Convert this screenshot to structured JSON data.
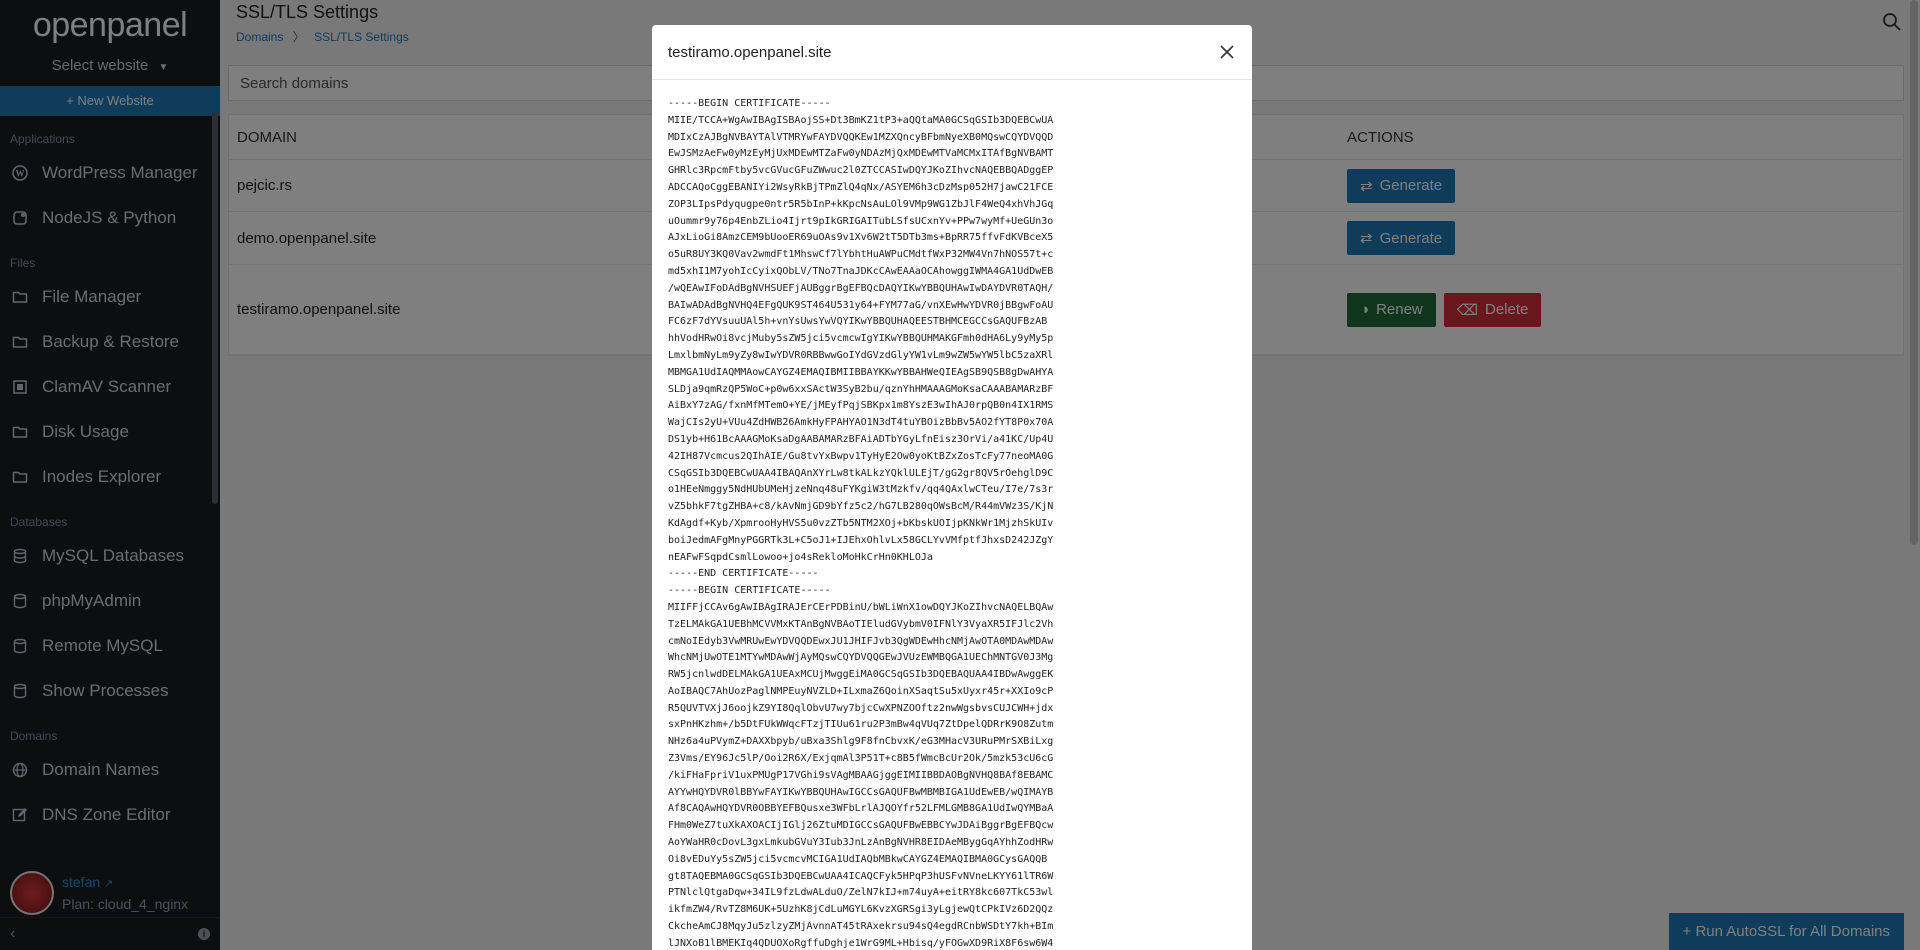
{
  "sidebar": {
    "logo": "openpanel",
    "select_website": "Select website",
    "new_website": "+ New Website",
    "sections": [
      {
        "label": "Applications",
        "items": [
          {
            "label": "WordPress Manager",
            "icon": "wordpress-icon"
          },
          {
            "label": "NodeJS & Python",
            "icon": "nodejs-icon"
          }
        ]
      },
      {
        "label": "Files",
        "items": [
          {
            "label": "File Manager",
            "icon": "folder-icon"
          },
          {
            "label": "Backup & Restore",
            "icon": "backup-icon"
          },
          {
            "label": "ClamAV Scanner",
            "icon": "scanner-icon"
          },
          {
            "label": "Disk Usage",
            "icon": "disk-icon"
          },
          {
            "label": "Inodes Explorer",
            "icon": "inodes-icon"
          }
        ]
      },
      {
        "label": "Databases",
        "items": [
          {
            "label": "MySQL Databases",
            "icon": "database-icon"
          },
          {
            "label": "phpMyAdmin",
            "icon": "phpmyadmin-icon"
          },
          {
            "label": "Remote MySQL",
            "icon": "remote-mysql-icon"
          },
          {
            "label": "Show Processes",
            "icon": "processes-icon"
          }
        ]
      },
      {
        "label": "Domains",
        "items": [
          {
            "label": "Domain Names",
            "icon": "globe-icon"
          },
          {
            "label": "DNS Zone Editor",
            "icon": "edit-icon"
          }
        ]
      }
    ],
    "user": {
      "name": "stefan",
      "plan": "Plan: cloud_4_nginx"
    }
  },
  "main": {
    "title": "SSL/TLS Settings",
    "breadcrumb": {
      "parent": "Domains",
      "current": "SSL/TLS Settings"
    },
    "search": {
      "placeholder": "Search domains"
    },
    "table": {
      "headers": {
        "domain": "DOMAIN",
        "actions": "ACTIONS"
      },
      "rows": [
        {
          "domain": "pejcic.rs",
          "actions": [
            "Generate"
          ]
        },
        {
          "domain": "demo.openpanel.site",
          "actions": [
            "Generate"
          ]
        },
        {
          "domain": "testiramo.openpanel.site",
          "actions": [
            "Renew",
            "Delete"
          ]
        }
      ]
    },
    "autossl_button": "+ Run AutoSSL for All Domains"
  },
  "modal": {
    "title": "testiramo.openpanel.site",
    "certificate": "-----BEGIN CERTIFICATE-----\nMIIE/TCCA+WgAwIBAgISBAojSS+Dt3BmKZ1tP3+aQQtaMA0GCSqGSIb3DQEBCwUA\nMDIxCzAJBgNVBAYTAlVTMRYwFAYDVQQKEw1MZXQncyBFbmNyeXB0MQswCQYDVQQD\nEwJSMzAeFw0yMzEyMjUxMDEwMTZaFw0yNDAzMjQxMDEwMTVaMCMxITAfBgNVBAMT\nGHRlc3RpcmFtby5vcGVucGFuZWwuc2l0ZTCCASIwDQYJKoZIhvcNAQEBBQADggEP\nADCCAQoCggEBANIYi2WsyRkBjTPmZlQ4qNx/ASYEM6h3cDzMsp052H7jawC21FCE\nZOP3LIpsPdyqugpe0ntr5R5bInP+kKpcNsAuLOl9VMp9WG1ZbJlF4WeQ4xhVhJGq\nuOummr9y76p4EnbZLio4Ijrt9pIkGRIGAITubLSfsUCxnYv+PPw7wyMf+UeGUn3o\nAJxLioGi8AmzCEM9bUooER69uOAs9v1Xv6W2tT5DTb3ms+BpRR75ffvFdKVBceX5\no5uR8UY3KQ0Vav2wmdFt1MhswCf7lYbhtHuAWPuCMdtfWxP32MW4Vn7hNOS57t+c\nmd5xhI1M7yohIcCyixQObLV/TNo7TnaJDKcCAwEAAaOCAhowggIWMA4GA1UdDwEB\n/wQEAwIFoDAdBgNVHSUEFjAUBggrBgEFBQcDAQYIKwYBBQUHAwIwDAYDVR0TAQH/\nBAIwADAdBgNVHQ4EFgQUK9ST464U531y64+FYM77aG/vnXEwHwYDVR0jBBgwFoAU\nFC6zF7dYVsuuUAl5h+vnYsUwsYwVQYIKwYBBQUHAQEESTBHMCEGCCsGAQUFBzAB\nhhVodHRwOi8vcjMuby5sZW5jci5vcmcwIgYIKwYBBQUHMAKGFmh0dHA6Ly9yMy5p\nLmxlbmNyLm9yZy8wIwYDVR0RBBwwGoIYdGVzdGlyYW1vLm9wZW5wYW5lbC5zaXRl\nMBMGA1UdIAQMMAowCAYGZ4EMAQIBMIIBBAYKKwYBBAHWeQIEAgSB9QSB8gDwAHYA\nSLDja9qmRzQP5WoC+p0w6xxSActW3SyB2bu/qznYhHMAAAGMoKsaCAAABAMARzBF\nAiBxY7zAG/fxnMfMTemO+YE/jMEyfPqjSBKpx1m8YszE3wIhAJ0rpQB0n4IX1RMS\nWajCIs2yU+VUu4ZdHWB26AmkHyFPAHYAO1N3dT4tuYBOizBbBv5AO2fYT8P0x70A\nDS1yb+H61BcAAAGMoKsaDgAABAMARzBFAiADTbYGyLfnEisz3OrVi/a41KC/Up4U\n42IH87Vcmcus2QIhAIE/Gu8tvYxBwpv1TyHyE2Ow0yoKtBZxZosTcFy77neoMA0G\nCSqGSIb3DQEBCwUAA4IBAQAnXYrLw8tkALkzYQklULEjT/gG2gr8QV5rOehglD9C\no1HEeNmggy5NdHUbUMeHjzeNnq48uFYKgiW3tMzkfv/qq4QAxlwCTeu/I7e/7s3r\nvZ5bhkF7tgZHBA+c8/kAvNmjGD9bYfz5c2/hG7LB280qOWsBcM/R44mVWz3S/KjN\nKdAgdf+Kyb/XpmrooHyHVS5u0vzZTb5NTM2XOj+bKbskUOIjpKNkWr1MjzhSkUIv\nboiJedmAFgMnyPGGRTk3L+C5oJ1+IJEhxOhlvLx58GCLYvVMfptfJhxsD242JZgY\nnEAFwFSqpdCsmlLowoo+jo4sRekloMoHkCrHn0KHLOJa\n-----END CERTIFICATE-----\n-----BEGIN CERTIFICATE-----\nMIIFFjCCAv6gAwIBAgIRAJErCErPDBinU/bWLiWnX1owDQYJKoZIhvcNAQELBQAw\nTzELMAkGA1UEBhMCVVMxKTAnBgNVBAoTIEludGVybmV0IFNlY3VyaXR5IFJlc2Vh\ncmNoIEdyb3VwMRUwEwYDVQQDEwxJU1JHIFJvb3QgWDEwHhcNMjAwOTA0MDAwMDAw\nWhcNMjUwOTE1MTYwMDAwWjAyMQswCQYDVQQGEwJVUzEWMBQGA1UEChMNTGV0J3Mg\nRW5jcnlwdDELMAkGA1UEAxMCUjMwggEiMA0GCSqGSIb3DQEBAQUAA4IBDwAwggEK\nAoIBAQC7AhUozPaglNMPEuyNVZLD+ILxmaZ6QoinXSaqtSu5xUyxr45r+XXIo9cP\nR5QUVTVXjJ6oojkZ9YI8QqlObvU7wy7bjcCwXPNZOOftz2nwWgsbvsCUJCWH+jdx\nsxPnHKzhm+/b5DtFUkWWqcFTzjTIUu61ru2P3mBw4qVUq7ZtDpelQDRrK9O8Zutm\nNHz6a4uPVymZ+DAXXbpyb/uBxa3Shlg9F8fnCbvxK/eG3MHacV3URuPMrSXBiLxg\nZ3Vms/EY96Jc5lP/Ooi2R6X/ExjqmAl3P51T+c8B5fWmcBcUr2Ok/5mzk53cU6cG\n/kiFHaFpriV1uxPMUgP17VGhi9sVAgMBAAGjggEIMIIBBDAOBgNVHQ8BAf8EBAMC\nAYYwHQYDVR0lBBYwFAYIKwYBBQUHAwIGCCsGAQUFBwMBMBIGA1UdEwEB/wQIMAYB\nAf8CAQAwHQYDVR0OBBYEFBQusxe3WFbLrlAJQOYfr52LFMLGMB8GA1UdIwQYMBaA\nFHm0WeZ7tuXkAXOACIjIGlj26ZtuMDIGCCsGAQUFBwEBBCYwJDAiBggrBgEFBQcw\nAoYWaHR0cDovL3gxLmkubGVuY3Iub3JnLzAnBgNVHR8EIDAeMBygGqAYhhZodHRw\nOi8vEDuYy5sZW5jci5vcmcvMCIGA1UdIAQbMBkwCAYGZ4EMAQIBMA0GCysGAQQB\ngt8TAQEBMA0GCSqGSIb3DQEBCwUAA4ICAQCFyk5HPqP3hUSFvNVneLKYY61lTR6W\nPTNlclQtgaDqw+34IL9fzLdwALduO/ZelN7kIJ+m74uyA+eitRY8kc607TkC53wl\nikfmZW4/RvTZ8M6UK+5UzhK8jCdLuMGYL6KvzXGRSgi3yLgjewQtCPkIVz6D2QQz\nCkcheAmCJ8MqyJu5zlzyZMjAvnnAT45tRAxekrsu94sQ4egdRCnbWSDtY7kh+BIm\nlJNXoB1lBMEKIq4QDUOXoRgffuDghje1WrG9ML+Hbisq/yFOGwXD9RiX8F6sw6W4"
  }
}
